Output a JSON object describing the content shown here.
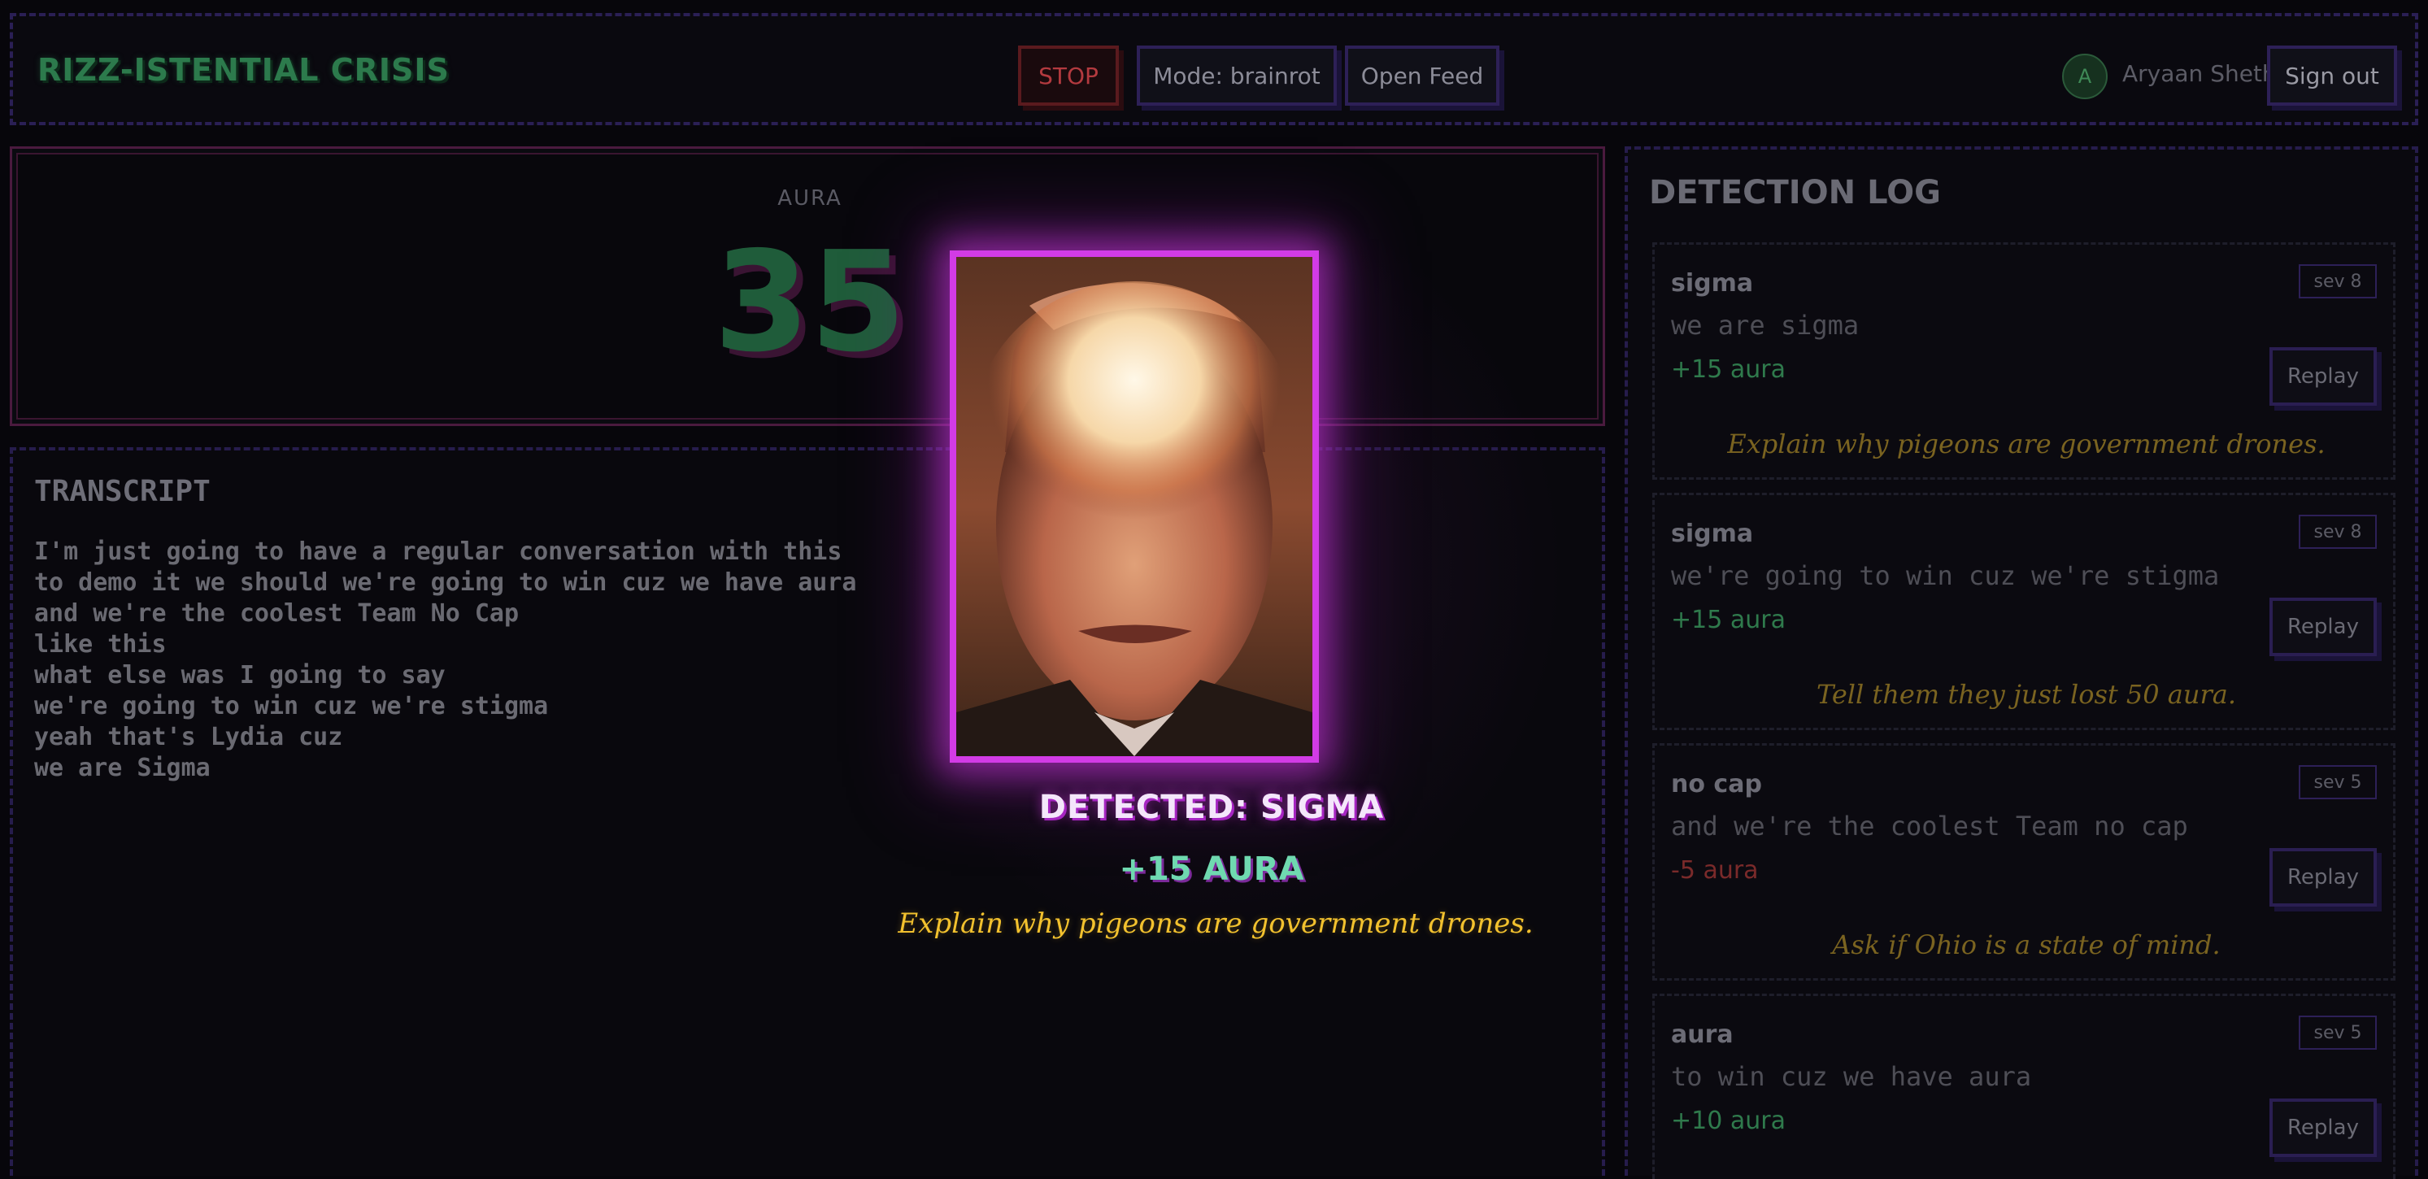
{
  "header": {
    "title": "RIZZ-ISTENTIAL CRISIS",
    "stop_label": "STOP",
    "mode_label": "Mode: brainrot",
    "open_feed_label": "Open Feed",
    "avatar_initial": "A",
    "user_name": "Aryaan Sheth",
    "sign_out_label": "Sign out"
  },
  "aura": {
    "label": "AURA",
    "value": "35"
  },
  "transcript": {
    "title": "TRANSCRIPT",
    "lines": [
      "I'm just going to have a regular conversation with this",
      "to demo it we should we're going to win cuz we have aura",
      "and we're the coolest Team No Cap",
      "like this",
      "what else was I going to say",
      "we're going to win cuz we're stigma",
      "yeah that's Lydia cuz",
      "we are Sigma"
    ]
  },
  "detection_log": {
    "title": "DETECTION LOG",
    "replay_label": "Replay",
    "entries": [
      {
        "keyword": "sigma",
        "severity": "sev 8",
        "quote": "we are sigma",
        "aura": "+15 aura",
        "aura_color": "#2f7a4c",
        "roast": "Explain why pigeons are government drones."
      },
      {
        "keyword": "sigma",
        "severity": "sev 8",
        "quote": "we're going to win cuz we're stigma",
        "aura": "+15 aura",
        "aura_color": "#2f7a4c",
        "roast": "Tell them they just lost 50 aura."
      },
      {
        "keyword": "no cap",
        "severity": "sev 5",
        "quote": "and we're the coolest Team no cap",
        "aura": "-5 aura",
        "aura_color": "#7a2a2a",
        "roast": "Ask if Ohio is a state of mind."
      },
      {
        "keyword": "aura",
        "severity": "sev 5",
        "quote": "to win cuz we have aura",
        "aura": "+10 aura",
        "aura_color": "#2f7a4c",
        "roast": ""
      }
    ]
  },
  "overlay": {
    "detected_text": "DETECTED: SIGMA",
    "aura_delta": "+15 AURA",
    "roast": "Explain why pigeons are government drones.",
    "accent_color": "#d23be6"
  }
}
